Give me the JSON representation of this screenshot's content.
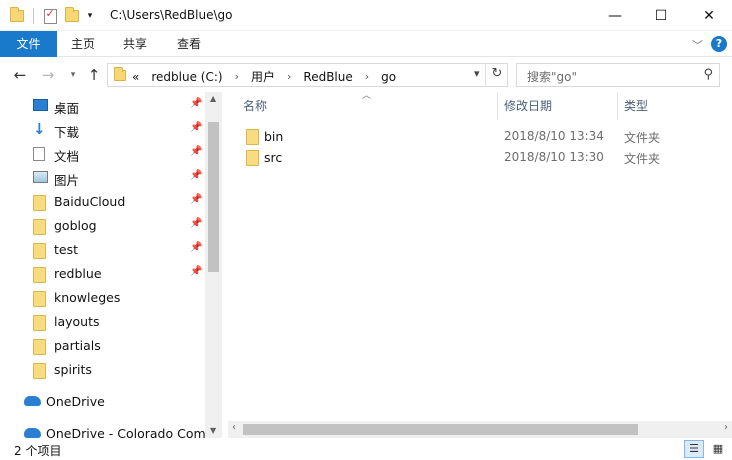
{
  "window": {
    "path_title": "C:\\Users\\RedBlue\\go",
    "minimize_glyph": "—",
    "maximize_glyph": "☐",
    "close_glyph": "✕"
  },
  "ribbon": {
    "tabs": [
      {
        "label": "文件"
      },
      {
        "label": "主页"
      },
      {
        "label": "共享"
      },
      {
        "label": "查看"
      }
    ],
    "help_glyph": "?"
  },
  "address": {
    "prefix": "«",
    "crumbs": [
      "redblue (C:)",
      "用户",
      "RedBlue",
      "go"
    ],
    "separator": "›"
  },
  "search": {
    "placeholder": "搜索\"go\""
  },
  "nav_pane": {
    "items": [
      {
        "label": "桌面",
        "icon": "desktop-icon",
        "pinned": true
      },
      {
        "label": "下载",
        "icon": "download-icon",
        "pinned": true
      },
      {
        "label": "文档",
        "icon": "document-icon",
        "pinned": true
      },
      {
        "label": "图片",
        "icon": "pictures-icon",
        "pinned": true
      },
      {
        "label": "BaiduCloud",
        "icon": "folder-icon",
        "pinned": true
      },
      {
        "label": "goblog",
        "icon": "folder-icon",
        "pinned": true
      },
      {
        "label": "test",
        "icon": "folder-icon",
        "pinned": true
      },
      {
        "label": "redblue",
        "icon": "folder-icon",
        "pinned": true
      },
      {
        "label": "knowleges",
        "icon": "folder-icon",
        "pinned": false
      },
      {
        "label": "layouts",
        "icon": "folder-icon",
        "pinned": false
      },
      {
        "label": "partials",
        "icon": "folder-icon",
        "pinned": false
      },
      {
        "label": "spirits",
        "icon": "folder-icon",
        "pinned": false
      }
    ],
    "cloud_items": [
      {
        "label": "OneDrive",
        "icon": "onedrive-icon"
      },
      {
        "label": "OneDrive - Colorado Comn",
        "icon": "onedrive-icon"
      }
    ]
  },
  "file_list": {
    "columns": {
      "name": "名称",
      "date": "修改日期",
      "type": "类型"
    },
    "rows": [
      {
        "name": "bin",
        "date": "2018/8/10 13:34",
        "type": "文件夹"
      },
      {
        "name": "src",
        "date": "2018/8/10 13:30",
        "type": "文件夹"
      }
    ]
  },
  "status": {
    "item_count": "2 个项目"
  }
}
